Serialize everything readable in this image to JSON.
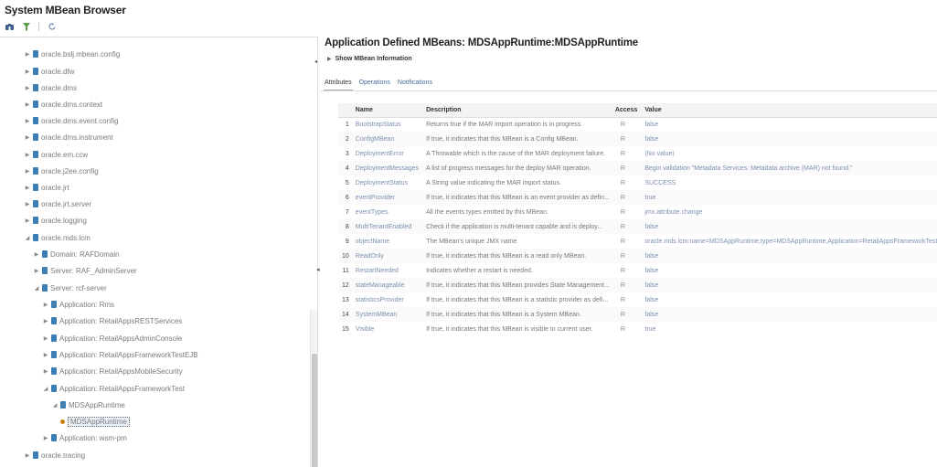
{
  "app": {
    "title": "System MBean Browser"
  },
  "toolbar": {
    "icons": [
      "binoculars-icon",
      "filter-icon",
      "refresh-icon"
    ]
  },
  "tree": [
    {
      "label": "oracle.bslj.mbean.config",
      "depth": 0,
      "expanded": false
    },
    {
      "label": "oracle.dfw",
      "depth": 0,
      "expanded": false
    },
    {
      "label": "oracle.dms",
      "depth": 0,
      "expanded": false
    },
    {
      "label": "oracle.dms.context",
      "depth": 0,
      "expanded": false
    },
    {
      "label": "oracle.dms.event.config",
      "depth": 0,
      "expanded": false
    },
    {
      "label": "oracle.dms.instrument",
      "depth": 0,
      "expanded": false
    },
    {
      "label": "oracle.em.ccw",
      "depth": 0,
      "expanded": false
    },
    {
      "label": "oracle.j2ee.config",
      "depth": 0,
      "expanded": false
    },
    {
      "label": "oracle.jrt",
      "depth": 0,
      "expanded": false
    },
    {
      "label": "oracle.jrt.server",
      "depth": 0,
      "expanded": false
    },
    {
      "label": "oracle.logging",
      "depth": 0,
      "expanded": false
    },
    {
      "label": "oracle.mds.lcm",
      "depth": 0,
      "expanded": true
    },
    {
      "label": "Domain: RAFDomain",
      "depth": 1,
      "expanded": false
    },
    {
      "label": "Server: RAF_AdminServer",
      "depth": 1,
      "expanded": false
    },
    {
      "label": "Server: rcf-server",
      "depth": 1,
      "expanded": true
    },
    {
      "label": "Application: Rms",
      "depth": 2,
      "expanded": false
    },
    {
      "label": "Application: RetailAppsRESTServices",
      "depth": 2,
      "expanded": false
    },
    {
      "label": "Application: RetailAppsAdminConsole",
      "depth": 2,
      "expanded": false
    },
    {
      "label": "Application: RetailAppsFrameworkTestEJB",
      "depth": 2,
      "expanded": false
    },
    {
      "label": "Application: RetailAppsMobileSecurity",
      "depth": 2,
      "expanded": false
    },
    {
      "label": "Application: RetailAppsFrameworkTest",
      "depth": 2,
      "expanded": true
    },
    {
      "label": "MDSAppRuntime",
      "depth": 3,
      "expanded": true
    },
    {
      "label": "MDSAppRuntime",
      "depth": 4,
      "leaf": true,
      "selected": true
    },
    {
      "label": "Application: wsm-pm",
      "depth": 2,
      "expanded": false
    },
    {
      "label": "oracle.tracing",
      "depth": 0,
      "expanded": false
    }
  ],
  "main": {
    "title": "Application Defined MBeans: MDSAppRuntime:MDSAppRuntime",
    "show_info": "Show MBean Information",
    "tabs": [
      "Attributes",
      "Operations",
      "Notifications"
    ],
    "active_tab": 0,
    "columns": [
      "",
      "Name",
      "Description",
      "Access",
      "Value"
    ],
    "rows": [
      {
        "n": "1",
        "name": "BootstrapStatus",
        "desc": "Returns true if the MAR import operation is in progress.",
        "access": "R",
        "value": "false",
        "link": true
      },
      {
        "n": "2",
        "name": "ConfigMBean",
        "desc": "If true, it indicates that this MBean is a Config MBean.",
        "access": "R",
        "value": "false",
        "link": true
      },
      {
        "n": "3",
        "name": "DeploymentError",
        "desc": "A Throwable which is the cause of the MAR deployment failure.",
        "access": "R",
        "value": "(No value)",
        "link": true
      },
      {
        "n": "4",
        "name": "DeploymentMessages",
        "desc": "A list of progress messages for the deploy MAR operation.",
        "access": "R",
        "value": "Begin validation \"Metadata Services: Metadata archive (MAR) not found.\"",
        "link": true
      },
      {
        "n": "5",
        "name": "DeploymentStatus",
        "desc": "A String value indicating the MAR import status.",
        "access": "R",
        "value": "SUCCESS",
        "link": true
      },
      {
        "n": "6",
        "name": "eventProvider",
        "desc": "If true, it indicates that this MBean is an event provider as defin...",
        "access": "R",
        "value": "true",
        "link": true
      },
      {
        "n": "7",
        "name": "eventTypes",
        "desc": "All the events types emitted by this MBean.",
        "access": "R",
        "value": "jmx.attribute.change",
        "link": true
      },
      {
        "n": "8",
        "name": "MultiTenantEnabled",
        "desc": "Check if the application is multi-tenant capable and is deploy...",
        "access": "R",
        "value": "false",
        "link": true
      },
      {
        "n": "9",
        "name": "objectName",
        "desc": "The MBean's unique JMX name",
        "access": "R",
        "value": "oracle.mds.lcm:name=MDSAppRuntime,type=MDSAppRuntime,Application=RetailAppsFrameworkTest",
        "link": true
      },
      {
        "n": "10",
        "name": "ReadOnly",
        "desc": "If true, it indicates that this MBean is a read only MBean.",
        "access": "R",
        "value": "false",
        "link": true
      },
      {
        "n": "11",
        "name": "RestartNeeded",
        "desc": "Indicates whether a restart is needed.",
        "access": "R",
        "value": "false",
        "link": true
      },
      {
        "n": "12",
        "name": "stateManageable",
        "desc": "If true, it indicates that this MBean provides State Management...",
        "access": "R",
        "value": "false",
        "link": true
      },
      {
        "n": "13",
        "name": "statisticsProvider",
        "desc": "If true, it indicates that this MBean is a statistic provider as defi...",
        "access": "R",
        "value": "false",
        "link": true
      },
      {
        "n": "14",
        "name": "SystemMBean",
        "desc": "If true, it indicates that this MBean is a System MBean.",
        "access": "R",
        "value": "false",
        "link": true
      },
      {
        "n": "15",
        "name": "Visible",
        "desc": "If true, it indicates that this MBean is visible to current user.",
        "access": "R",
        "value": "true",
        "link": true
      }
    ]
  }
}
